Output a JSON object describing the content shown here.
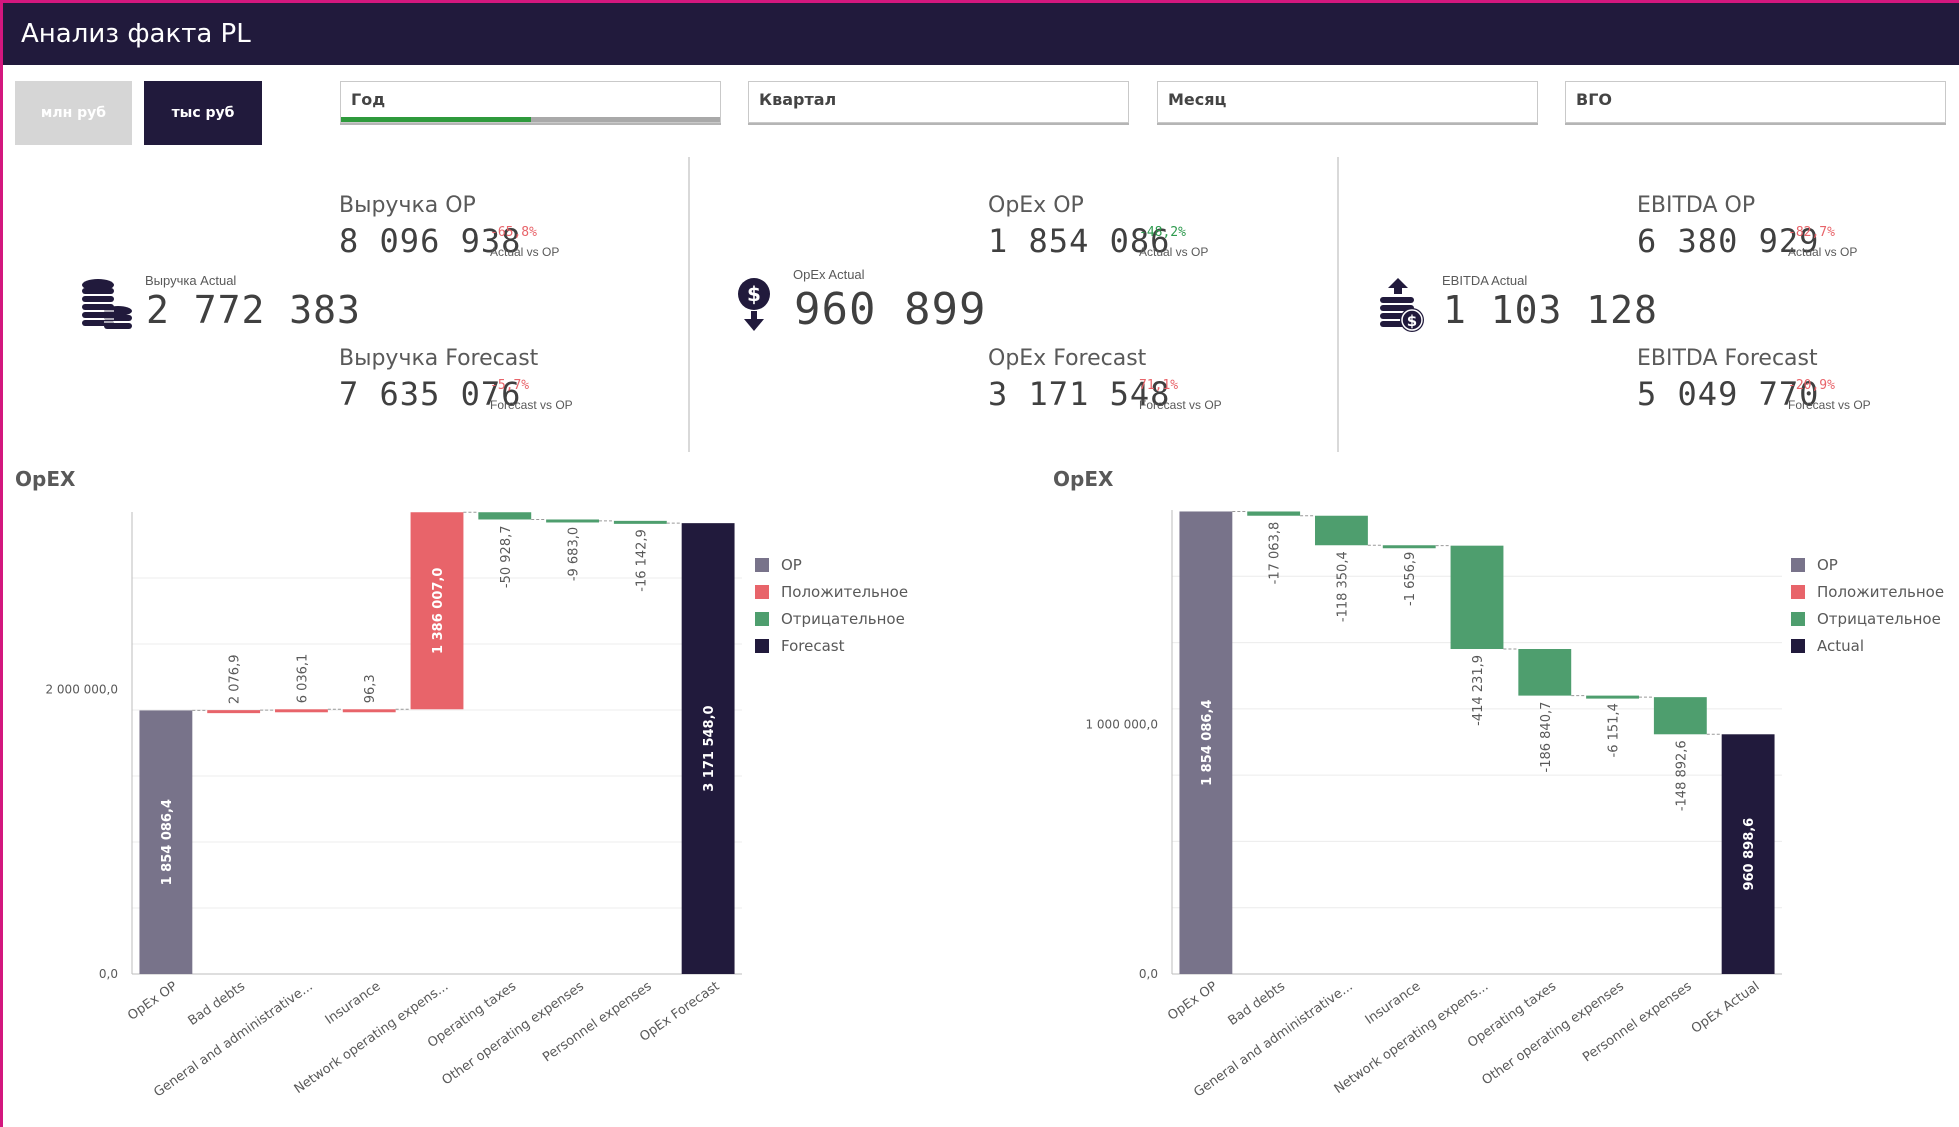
{
  "header": {
    "title": "Анализ факта PL"
  },
  "units": {
    "mln_label": "млн руб",
    "tys_label": "тыс руб",
    "selected": "тыс руб"
  },
  "filters": [
    {
      "label": "Год",
      "progress": 0.5
    },
    {
      "label": "Квартал"
    },
    {
      "label": "Месяц"
    },
    {
      "label": "ВГО"
    }
  ],
  "colors": {
    "op": "#78738a",
    "positive": "#e8646a",
    "negative": "#4e9e6e",
    "total": "#211a3c",
    "accent": "#d3177e"
  },
  "kpis": [
    {
      "icon": "coins-stack-icon",
      "actual_label": "Выручка Actual",
      "actual_value": "2 772 383",
      "op_label": "Выручка OP",
      "op_value": "8 096 938",
      "op_pct": "-65,8%",
      "op_cmp": "Actual vs OP",
      "op_pct_tone": "neg",
      "fc_label": "Выручка Forecast",
      "fc_value": "7 635 076",
      "fc_pct": "-5,7%",
      "fc_cmp": "Forecast vs OP",
      "fc_pct_tone": "neg"
    },
    {
      "icon": "dollar-down-icon",
      "actual_label": "OpEx Actual",
      "actual_value": "960 899",
      "op_label": "OpEx OP",
      "op_value": "1 854 086",
      "op_pct": "-48,2%",
      "op_cmp": "Actual vs OP",
      "op_pct_tone": "pos",
      "fc_label": "OpEx Forecast",
      "fc_value": "3 171 548",
      "fc_pct": "71,1%",
      "fc_cmp": "Forecast vs OP",
      "fc_pct_tone": "neg"
    },
    {
      "icon": "coins-up-icon",
      "actual_label": "EBITDA Actual",
      "actual_value": "1 103 128",
      "op_label": "EBITDA OP",
      "op_value": "6 380 929",
      "op_pct": "-82,7%",
      "op_cmp": "Actual vs OP",
      "op_pct_tone": "neg",
      "fc_label": "EBITDA Forecast",
      "fc_value": "5 049 770",
      "fc_pct": "-20,9%",
      "fc_cmp": "Forecast vs OP",
      "fc_pct_tone": "neg"
    }
  ],
  "chart_data": [
    {
      "type": "waterfall",
      "title": "OpEX",
      "categories": [
        "OpEx OP",
        "Bad debts",
        "General and administrative...",
        "Insurance",
        "Network operating expens...",
        "Operating taxes",
        "Other operating expenses",
        "Personnel expenses",
        "OpEx Forecast"
      ],
      "values": [
        1854086.4,
        2076.9,
        6036.1,
        96.3,
        1386007.0,
        -50928.7,
        -9683.0,
        -16142.9,
        3171548.0
      ],
      "labels": [
        "1 854 086,4",
        "2 076,9",
        "6 036,1",
        "96,3",
        "1 386 007,0",
        "-50 928,7",
        "-9 683,0",
        "-16 142,9",
        "3 171 548,0"
      ],
      "kinds": [
        "op",
        "positive",
        "positive",
        "positive",
        "positive",
        "negative",
        "negative",
        "negative",
        "total"
      ],
      "ylim": [
        0,
        3250000
      ],
      "yticks": [
        0,
        2000000
      ],
      "ytick_labels": [
        "0,0",
        "2 000 000,0"
      ],
      "grid": true,
      "legend_position": "right",
      "legend": [
        {
          "name": "OP",
          "kind": "op"
        },
        {
          "name": "Положительное",
          "kind": "positive"
        },
        {
          "name": "Отрицательное",
          "kind": "negative"
        },
        {
          "name": "Forecast",
          "kind": "total"
        }
      ]
    },
    {
      "type": "waterfall",
      "title": "OpEX",
      "categories": [
        "OpEx OP",
        "Bad debts",
        "General and administrative...",
        "Insurance",
        "Network operating expens...",
        "Operating taxes",
        "Other operating expenses",
        "Personnel expenses",
        "OpEx Actual"
      ],
      "values": [
        1854086.4,
        -17063.8,
        -118350.4,
        -1656.9,
        -414231.9,
        -186840.7,
        -6151.4,
        -148892.6,
        960898.6
      ],
      "labels": [
        "1 854 086,4",
        "-17 063,8",
        "-118 350,4",
        "-1 656,9",
        "-414 231,9",
        "-186 840,7",
        "-6 151,4",
        "-148 892,6",
        "960 898,6"
      ],
      "kinds": [
        "op",
        "negative",
        "negative",
        "negative",
        "negative",
        "negative",
        "negative",
        "negative",
        "total"
      ],
      "ylim": [
        0,
        1860000
      ],
      "yticks": [
        0,
        1000000
      ],
      "ytick_labels": [
        "0,0",
        "1 000 000,0"
      ],
      "grid": true,
      "legend_position": "right",
      "legend": [
        {
          "name": "OP",
          "kind": "op"
        },
        {
          "name": "Положительное",
          "kind": "positive"
        },
        {
          "name": "Отрицательное",
          "kind": "negative"
        },
        {
          "name": "Actual",
          "kind": "total"
        }
      ]
    }
  ]
}
